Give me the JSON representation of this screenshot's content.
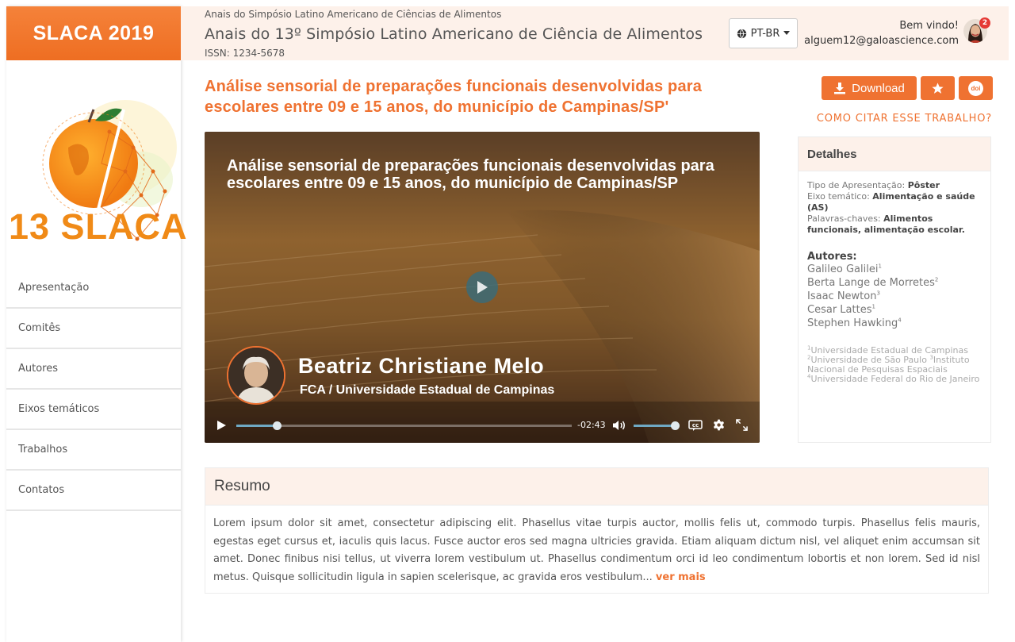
{
  "sidebar": {
    "brand": "SLACA 2019",
    "logo_text": "13 SLACA",
    "items": [
      {
        "label": "Apresentação"
      },
      {
        "label": "Comitês"
      },
      {
        "label": "Autores"
      },
      {
        "label": "Eixos temáticos"
      },
      {
        "label": "Trabalhos"
      },
      {
        "label": "Contatos"
      }
    ]
  },
  "header": {
    "subtitle": "Anais do Simpósio Latino Americano de Ciências de Alimentos",
    "title": "Anais do 13º Simpósio Latino Americano de Ciência de Alimentos",
    "issn": "ISSN: 1234-5678",
    "language": "PT-BR",
    "welcome": "Bem vindo!",
    "email": "alguem12@galoascience.com",
    "notification_count": "2"
  },
  "paper": {
    "title": "Análise sensorial de preparações funcionais desenvolvidas para escolares entre 09 e 15 anos, do município de Campinas/SP'",
    "download_label": "Download",
    "doi_label": "doi",
    "cite_label": "COMO CITAR ESSE TRABALHO?"
  },
  "video": {
    "title": "Análise sensorial de preparações funcionais desenvolvidas para escolares entre 09 e 15 anos, do município de Campinas/SP",
    "presenter_name": "Beatriz Christiane Melo",
    "presenter_institution": "FCA / Universidade Estadual de Campinas",
    "time_remaining": "-02:43",
    "progress": 0.12,
    "volume": 1.0
  },
  "details": {
    "heading": "Detalhes",
    "tipo_label": "Tipo de Apresentação:",
    "tipo_value": "Pôster",
    "eixo_label": "Eixo temático:",
    "eixo_value": "Alimentação e saúde (AS)",
    "palavras_label": "Palavras-chaves:",
    "palavras_value": "Alimentos funcionais, alimentação escolar.",
    "authors_heading": "Autores:",
    "authors": [
      {
        "name": "Galileo Galilei",
        "sup": "1"
      },
      {
        "name": "Berta Lange de Morretes",
        "sup": "2"
      },
      {
        "name": "Isaac Newton",
        "sup": "3"
      },
      {
        "name": "Cesar Lattes",
        "sup": "1"
      },
      {
        "name": "Stephen Hawking",
        "sup": "4"
      }
    ],
    "affiliations": [
      {
        "sup": "1",
        "name": "Universidade Estadual de Campinas"
      },
      {
        "sup": "2",
        "name": "Universidade de São Paulo"
      },
      {
        "sup": "3",
        "name": "Instituto Nacional de Pesquisas Espaciais"
      },
      {
        "sup": "4",
        "name": "Universidade Federal do Rio de Janeiro"
      }
    ]
  },
  "resumo": {
    "heading": "Resumo",
    "text": "Lorem ipsum dolor sit amet, consectetur adipiscing elit. Phasellus vitae turpis auctor, mollis felis ut, commodo turpis. Phasellus felis mauris, egestas eget cursus et, iaculis quis lacus. Fusce auctor eros sed magna ultricies gravida. Etiam aliquam dictum nisl, vel aliquet enim accumsan sit amet. Donec finibus nisi tellus, ut viverra lorem vestibulum ut. Phasellus condimentum orci id leo condimentum lobortis et non lorem. Sed id nisl metus. Quisque sollicitudin ligula in sapien scelerisque, ac gravida eros vestibulum...",
    "more_label": "ver mais"
  },
  "colors": {
    "accent": "#ef7231",
    "header_bg": "#fdf1ea",
    "logo_orange": "#f08a17"
  }
}
